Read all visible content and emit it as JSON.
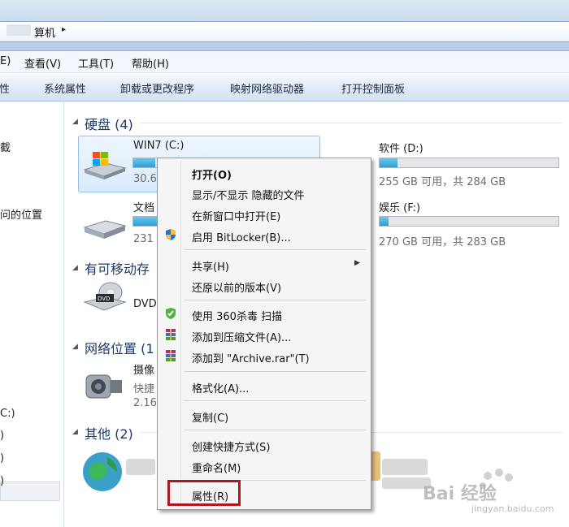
{
  "address": {
    "path_fragment": "算机",
    "arrow": "▸"
  },
  "menu": [
    "E)",
    "查看(V)",
    "工具(T)",
    "帮助(H)"
  ],
  "toolbar": [
    "属性",
    "系统属性",
    "卸载或更改程序",
    "映射网络驱动器",
    "打开控制面板"
  ],
  "nav": [
    "截",
    "问的位置",
    "C:)",
    ")",
    ")",
    ")"
  ],
  "groups": {
    "hdd": "硬盘 (4)",
    "removable": "有可移动存",
    "network": "网络位置 (1",
    "other": "其他 (2)"
  },
  "drives": {
    "c": {
      "name": "WIN7 (C:)",
      "size": "30.6",
      "fill": 0.85
    },
    "doc": {
      "name": "文档",
      "size": "231",
      "fill": 0.2
    },
    "d": {
      "name": "软件 (D:)",
      "size": "255 GB 可用，共 284 GB",
      "fill": 0.1
    },
    "f": {
      "name": "娱乐 (F:)",
      "size": "270 GB 可用，共 283 GB",
      "fill": 0.05
    }
  },
  "dvd": {
    "name": "DVD"
  },
  "camera": {
    "name": "摄像",
    "line2": "快捷",
    "line3": "2.16"
  },
  "context_menu": {
    "open": "打开(O)",
    "toggle_hidden": "显示/不显示 隐藏的文件",
    "open_new_window": "在新窗口中打开(E)",
    "bitlocker": "启用 BitLocker(B)...",
    "share": "共享(H)",
    "restore": "还原以前的版本(V)",
    "scan360": "使用 360杀毒 扫描",
    "add_archive": "添加到压缩文件(A)...",
    "add_rar": "添加到 \"Archive.rar\"(T)",
    "format": "格式化(A)...",
    "copy": "复制(C)",
    "shortcut": "创建快捷方式(S)",
    "rename": "重命名(M)",
    "properties": "属性(R)"
  },
  "watermark": {
    "text": "Bai 经验",
    "sub": "jingyan.baidu.com"
  },
  "colors": {
    "highlight": "#b3151f",
    "bar_fill": "#26a0da",
    "selection": "#d9ebfc"
  }
}
